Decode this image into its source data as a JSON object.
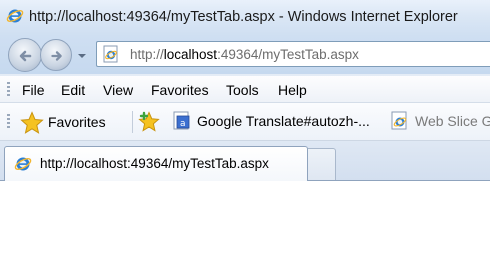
{
  "window": {
    "title": "http://localhost:49364/myTestTab.aspx - Windows Internet Explorer"
  },
  "address": {
    "prefix": "http://",
    "host": "localhost",
    "rest": ":49364/myTestTab.aspx"
  },
  "menu": {
    "items": [
      "File",
      "Edit",
      "View",
      "Favorites",
      "Tools",
      "Help"
    ]
  },
  "favorites_bar": {
    "favorites_label": "Favorites",
    "links": [
      {
        "label": "Google Translate#autozh-...",
        "icon": "translate-icon"
      },
      {
        "label": "Web Slice G",
        "icon": "ie-page-icon"
      }
    ]
  },
  "tabs": {
    "active_label": "http://localhost:49364/myTestTab.aspx"
  },
  "colors": {
    "chrome_blue": "#cfdff2",
    "ie_blue": "#1f6fc5",
    "ie_orbit": "#f2b630",
    "star_gold": "#f5c221",
    "plus_green": "#3da33d"
  }
}
